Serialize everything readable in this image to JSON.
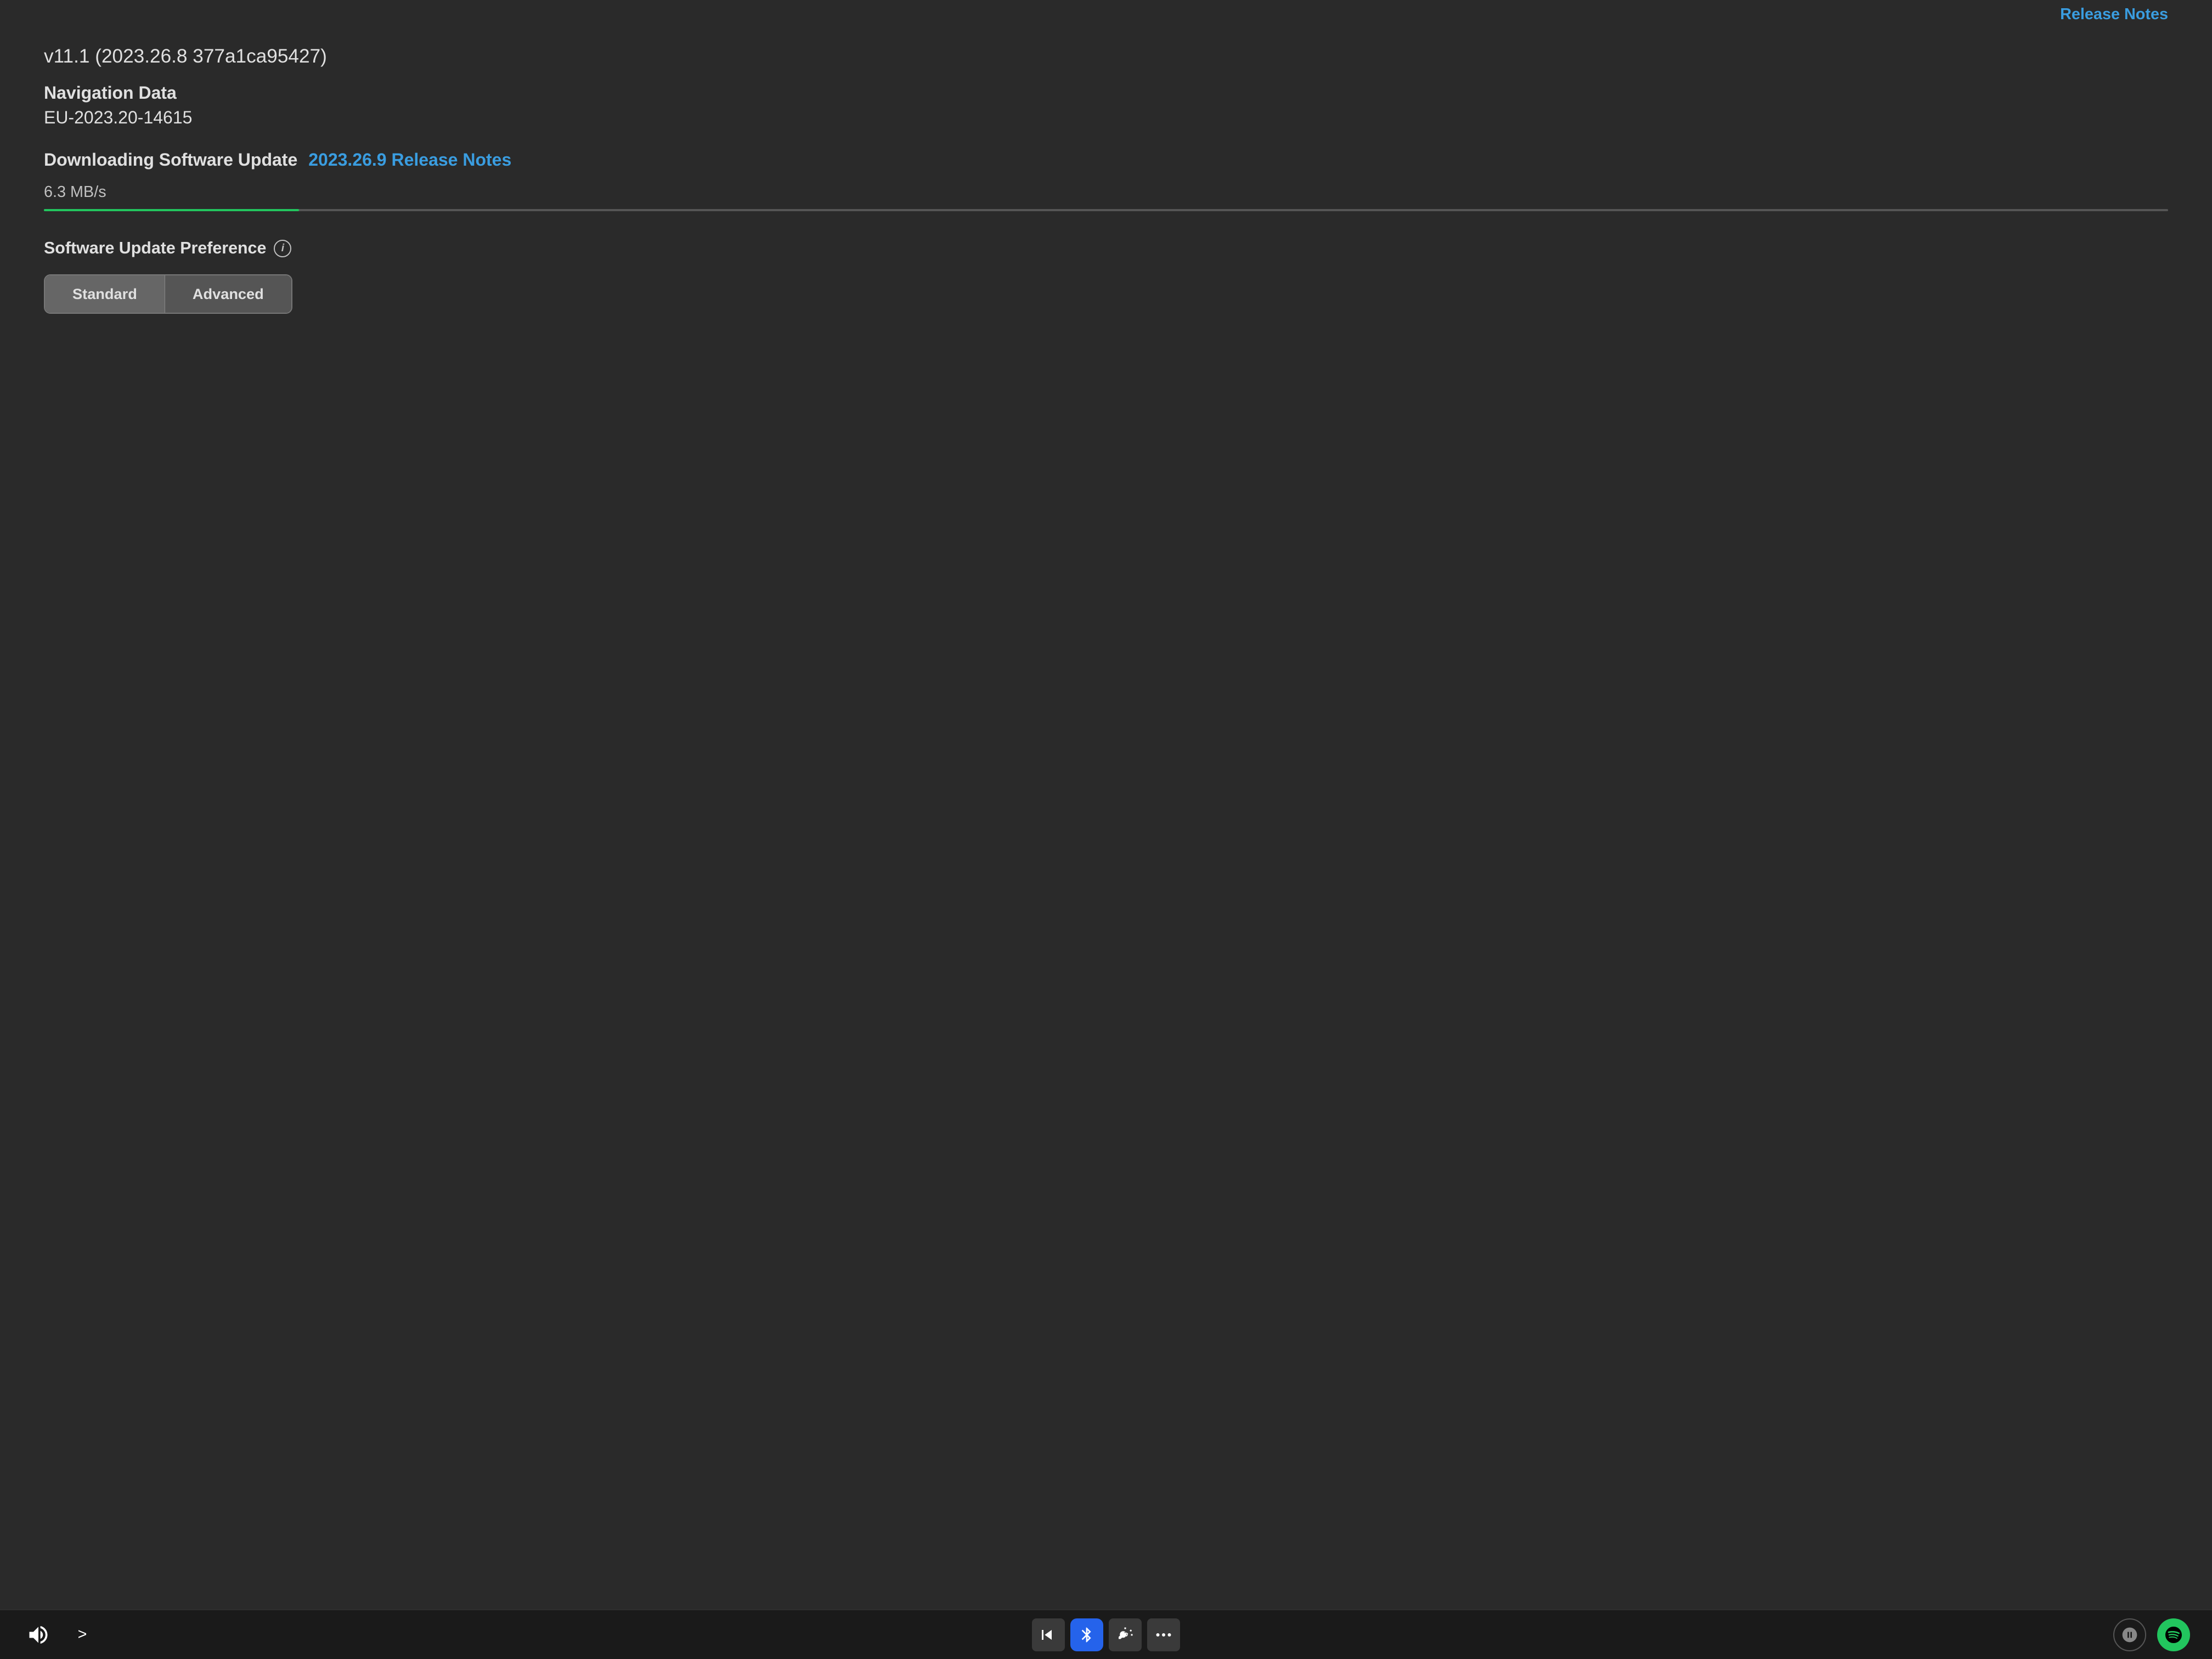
{
  "top": {
    "release_notes_partial": "Release Notes"
  },
  "content": {
    "version": "v11.1 (2023.26.8 377a1ca95427)",
    "nav_data_label": "Navigation Data",
    "nav_data_value": "EU-2023.20-14615",
    "downloading_label": "Downloading Software Update",
    "release_notes_link": "2023.26.9 Release Notes",
    "speed": "6.3 MB/s",
    "progress_percent": 12,
    "preference_label": "Software Update Preference",
    "info_symbol": "i",
    "button_standard": "Standard",
    "button_advanced": "Advanced"
  },
  "taskbar": {
    "volume_label": "volume",
    "chevron_label": ">",
    "media_label": "media",
    "bluetooth_label": "bluetooth",
    "gauge_label": "gauge",
    "dots_label": "more",
    "camera_label": "camera",
    "spotify_label": "spotify"
  }
}
